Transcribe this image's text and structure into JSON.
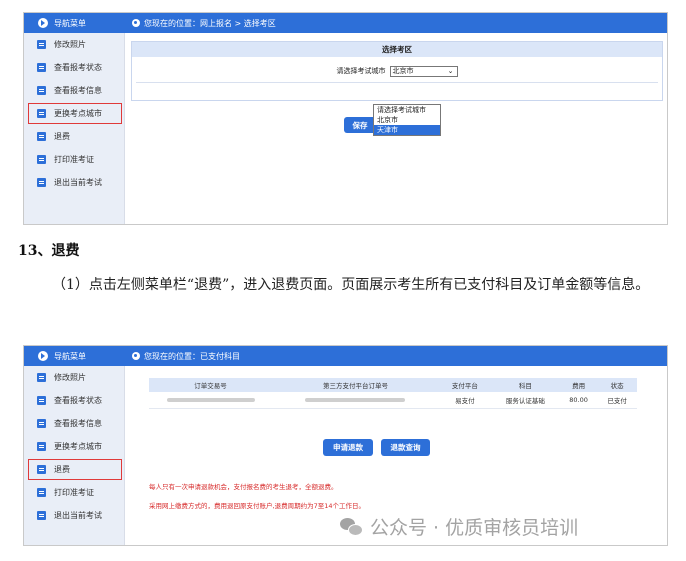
{
  "shot1": {
    "nav_title": "导航菜单",
    "breadcrumb": "您现在的位置：网上报名 > 选择考区",
    "sidebar": [
      "修改照片",
      "查看报考状态",
      "查看报考信息",
      "更换考点城市",
      "退费",
      "打印准考证",
      "退出当前考试"
    ],
    "highlighted_item": "更换考点城市",
    "form": {
      "header": "选择考区",
      "label": "请选择考试城市",
      "selected": "北京市",
      "options": [
        "请选择考试城市",
        "北京市",
        "天津市"
      ],
      "hover_option": "天津市",
      "save_label": "保存"
    }
  },
  "doc": {
    "heading": "13、退费",
    "paragraph": "（1）点击左侧菜单栏“退费”，进入退费页面。页面展示考生所有已支付科目及订单金额等信息。"
  },
  "shot2": {
    "nav_title": "导航菜单",
    "breadcrumb": "您现在的位置：已支付科目",
    "sidebar": [
      "修改照片",
      "查看报考状态",
      "查看报考信息",
      "更换考点城市",
      "退费",
      "打印准考证",
      "退出当前考试"
    ],
    "highlighted_item": "退费",
    "table": {
      "headers": [
        "订单交易号",
        "第三方支付平台订单号",
        "支付平台",
        "科目",
        "费用",
        "状态"
      ],
      "row": {
        "platform": "易支付",
        "subject": "服务认证基础",
        "fee": "80.00",
        "status": "已支付"
      }
    },
    "buttons": {
      "apply": "申请退款",
      "query": "退款查询"
    },
    "notes": [
      "每人只有一次申请退款机会，支付报名费的考生退考，全额退费。",
      "采用网上缴费方式的，费用退回原支付账户,退费周期约为7至14个工作日。"
    ]
  },
  "watermark": "公众号 · 优质审核员培训"
}
